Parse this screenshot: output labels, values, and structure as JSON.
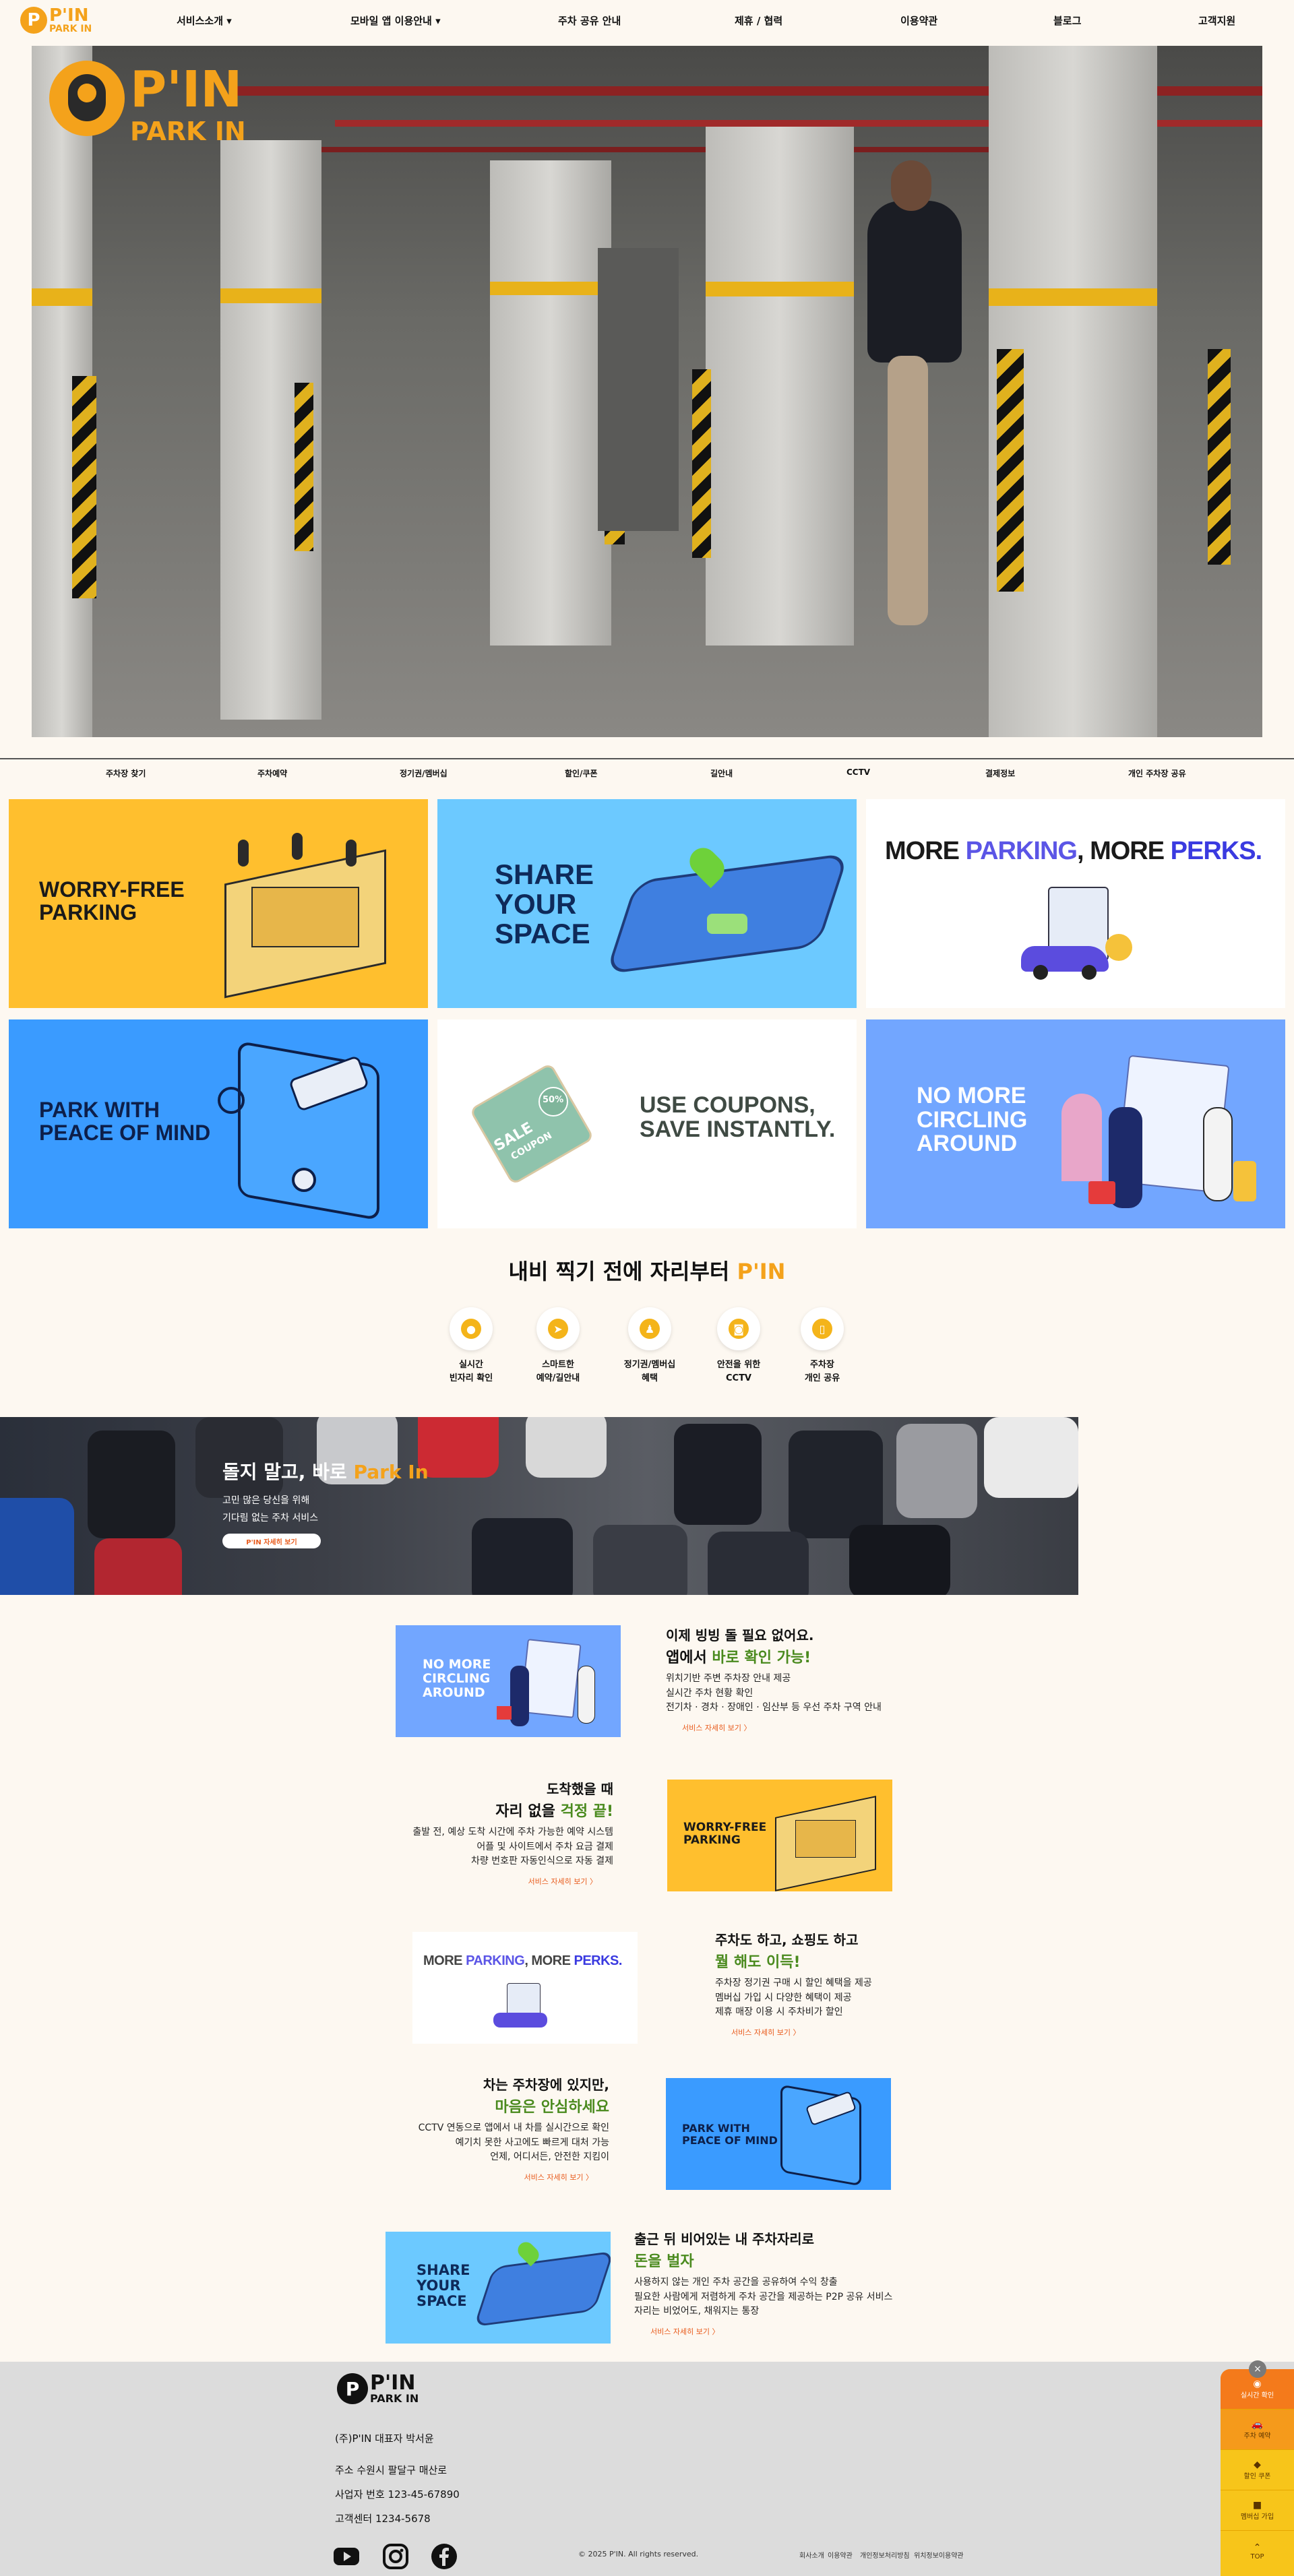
{
  "brand": {
    "p": "P",
    "line1": "P'IN",
    "line2": "PARK IN",
    "hero_line1": "P'IN",
    "hero_line2": "PARK IN",
    "color": "#f4a21b"
  },
  "nav": [
    "서비스소개 ▾",
    "모바일 앱 이용안내 ▾",
    "주차 공유 안내",
    "제휴 / 협력",
    "이용약관",
    "블로그",
    "고객지원"
  ],
  "categories": [
    "주차장 찾기",
    "주차예약",
    "정기권/멤버십",
    "할인/쿠폰",
    "길안내",
    "CCTV",
    "결제정보",
    "개인 주차장 공유"
  ],
  "tiles": [
    {
      "title": "WORRY-FREE\nPARKING",
      "bg": "#ffbf2e"
    },
    {
      "title": "SHARE\nYOUR\nSPACE",
      "bg": "#6cc9ff"
    },
    {
      "title": "MORE PARKING, MORE PERKS.",
      "bg": "#ffffff"
    },
    {
      "title": "PARK WITH\nPEACE OF MIND",
      "bg": "#3a9bff"
    },
    {
      "title": "USE COUPONS,\nSAVE INSTANTLY.",
      "bg": "#ffffff"
    },
    {
      "title": "NO MORE\nCIRCLING\nAROUND",
      "bg": "#72a6ff"
    }
  ],
  "tile_words": {
    "more": "MORE ",
    "parking": "PARKING",
    "comma_more": ", MORE ",
    "perks": "PERKS.",
    "sale": "SALE",
    "coupon": "COUPON",
    "pct": "50%"
  },
  "features": {
    "heading_prefix": "내비 찍기 전에 자리부터 ",
    "heading_accent": "P'IN",
    "items": [
      {
        "label": "실시간\n빈자리 확인",
        "icon": "location-pin-icon",
        "glyph": "●"
      },
      {
        "label": "스마트한\n예약/길안내",
        "icon": "navigation-arrow-icon",
        "glyph": "➤"
      },
      {
        "label": "정기권/멤버십\n혜택",
        "icon": "person-icon",
        "glyph": "♟"
      },
      {
        "label": "안전을 위한\nCCTV",
        "icon": "cctv-icon",
        "glyph": "◙"
      },
      {
        "label": "주차장\n개인 공유",
        "icon": "phone-share-icon",
        "glyph": "▯"
      }
    ]
  },
  "banner": {
    "title_prefix": "돌지 말고, 바로 ",
    "title_accent": "Park In",
    "sub1": "고민 많은 당신을 위해",
    "sub2": "기다림 없는 주차 서비스",
    "button": "P'IN 자세히 보기"
  },
  "services": [
    {
      "h1": "이제 빙빙 돌 필요 없어요.",
      "h2_a": "앱에서 ",
      "h2_b": "바로 확인 가능!",
      "desc": "위치기반 주변 주차장 안내 제공\n실시간 주차 현황 확인\n전기차 · 경차 · 장애인 · 임산부 등 우선 주차 구역 안내",
      "more": "서비스 자세히 보기 〉",
      "img_title": "NO MORE\nCIRCLING\nAROUND"
    },
    {
      "h1": "도착했을 때",
      "h2_a": "자리 없을 ",
      "h2_b": "걱정 끝!",
      "desc": "출발 전, 예상 도착 시간에 주차 가능한 예약 시스템\n어플 및 사이트에서 주차 요금 결제\n차량 번호판 자동인식으로 자동 결제",
      "more": "서비스 자세히 보기 〉",
      "img_title": "WORRY-FREE\nPARKING"
    },
    {
      "h1": "주차도 하고, 쇼핑도 하고",
      "h2_a": "",
      "h2_b": "뭘 해도 이득!",
      "desc": "주차장 정기권 구매 시 할인 혜택을 제공\n멤버십 가입 시 다양한 혜택이 제공\n제휴 매장 이용 시 주차비가 할인",
      "more": "서비스 자세히 보기 〉",
      "img_title": "MORE PARKING, MORE PERKS."
    },
    {
      "h1": "차는 주차장에 있지만,",
      "h2_a": "",
      "h2_b": "마음은 안심하세요",
      "desc": "CCTV 연동으로 앱에서 내 차를 실시간으로 확인\n예기치 못한 사고에도 빠르게 대처 가능\n언제, 어디서든, 안전한 지킴이",
      "more": "서비스 자세히 보기 〉",
      "img_title": "PARK WITH\nPEACE OF MIND"
    },
    {
      "h1": "출근 뒤 비어있는 내 주차자리로",
      "h2_a": "",
      "h2_b": "돈을 벌자",
      "desc": "사용하지 않는 개인 주차 공간을 공유하여 수익 창출\n필요한 사람에게 저렴하게 주차 공간을 제공하는 P2P 공유 서비스\n자리는 비었어도, 채워지는 통장",
      "more": "서비스 자세히 보기 〉",
      "img_title": "SHARE\nYOUR\nSPACE"
    }
  ],
  "footer": {
    "company": "(주)P'IN 대표자 박서윤",
    "address": "주소 수원시 팔달구 매산로",
    "biz": "사업자 번호 123-45-67890",
    "cs": "고객센터 1234-5678",
    "copyright": "© 2025 P'IN. All rights reserved.",
    "links": [
      "회사소개",
      "이용약관",
      "개인정보처리방침",
      "위치정보이용약관"
    ],
    "social": [
      "youtube-icon",
      "instagram-icon",
      "facebook-icon"
    ]
  },
  "float_menu": {
    "close": "×",
    "items": [
      {
        "label": "실시간 확인",
        "glyph": "◉"
      },
      {
        "label": "주차 예약",
        "glyph": "🚗"
      },
      {
        "label": "할인 쿠폰",
        "glyph": "◆"
      },
      {
        "label": "멤버십 가입",
        "glyph": "■"
      },
      {
        "label": "TOP",
        "glyph": "⌃"
      }
    ]
  }
}
